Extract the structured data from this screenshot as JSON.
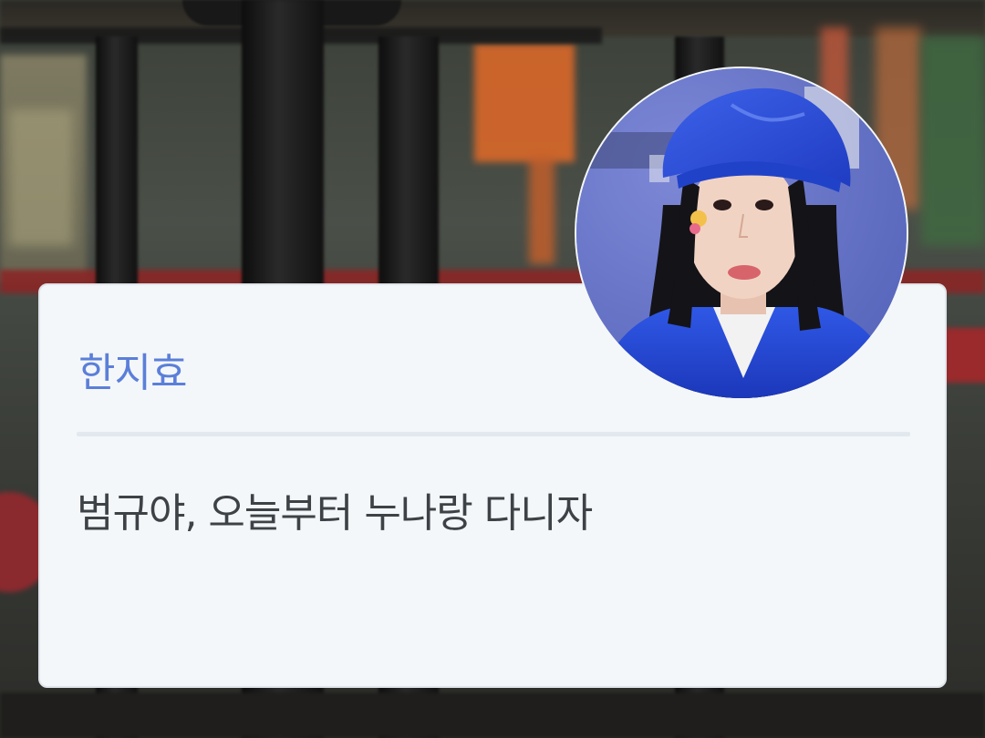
{
  "dialogue": {
    "speaker_name": "한지효",
    "text": "범규야, 오늘부터 누나랑 다니자"
  },
  "avatar": {
    "description_icon": "character-portrait-icon",
    "hat_color": "#2d4fd6",
    "backdrop_color": "#6f7ed0"
  },
  "theme": {
    "name_color": "#5b7fd9",
    "text_color": "#3d4247",
    "card_background": "#f4f7f9"
  }
}
